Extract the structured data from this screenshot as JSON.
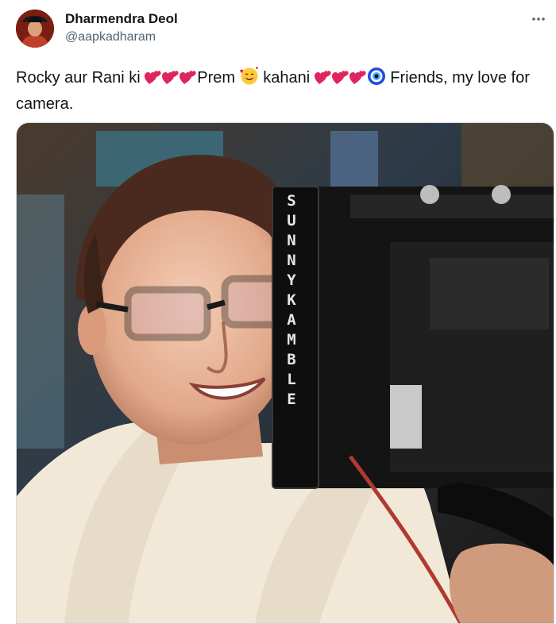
{
  "author": {
    "display_name": "Dharmendra Deol",
    "handle": "@aapkadharam"
  },
  "post": {
    "text_parts": {
      "p1": "Rocky aur Rani ki",
      "p2": "Prem",
      "p3": "kahani",
      "p4": "Friends, my love for camera."
    },
    "image_overlay_text": "SUNNYKAMBLE"
  },
  "icons": {
    "more": "more-horizontal-icon",
    "heart": "two-hearts-emoji",
    "smile": "smiling-face-with-hearts-emoji",
    "evil_eye": "nazar-amulet-emoji"
  },
  "colors": {
    "text": "#0f1419",
    "secondary": "#536471",
    "heart": "#e0245e"
  }
}
